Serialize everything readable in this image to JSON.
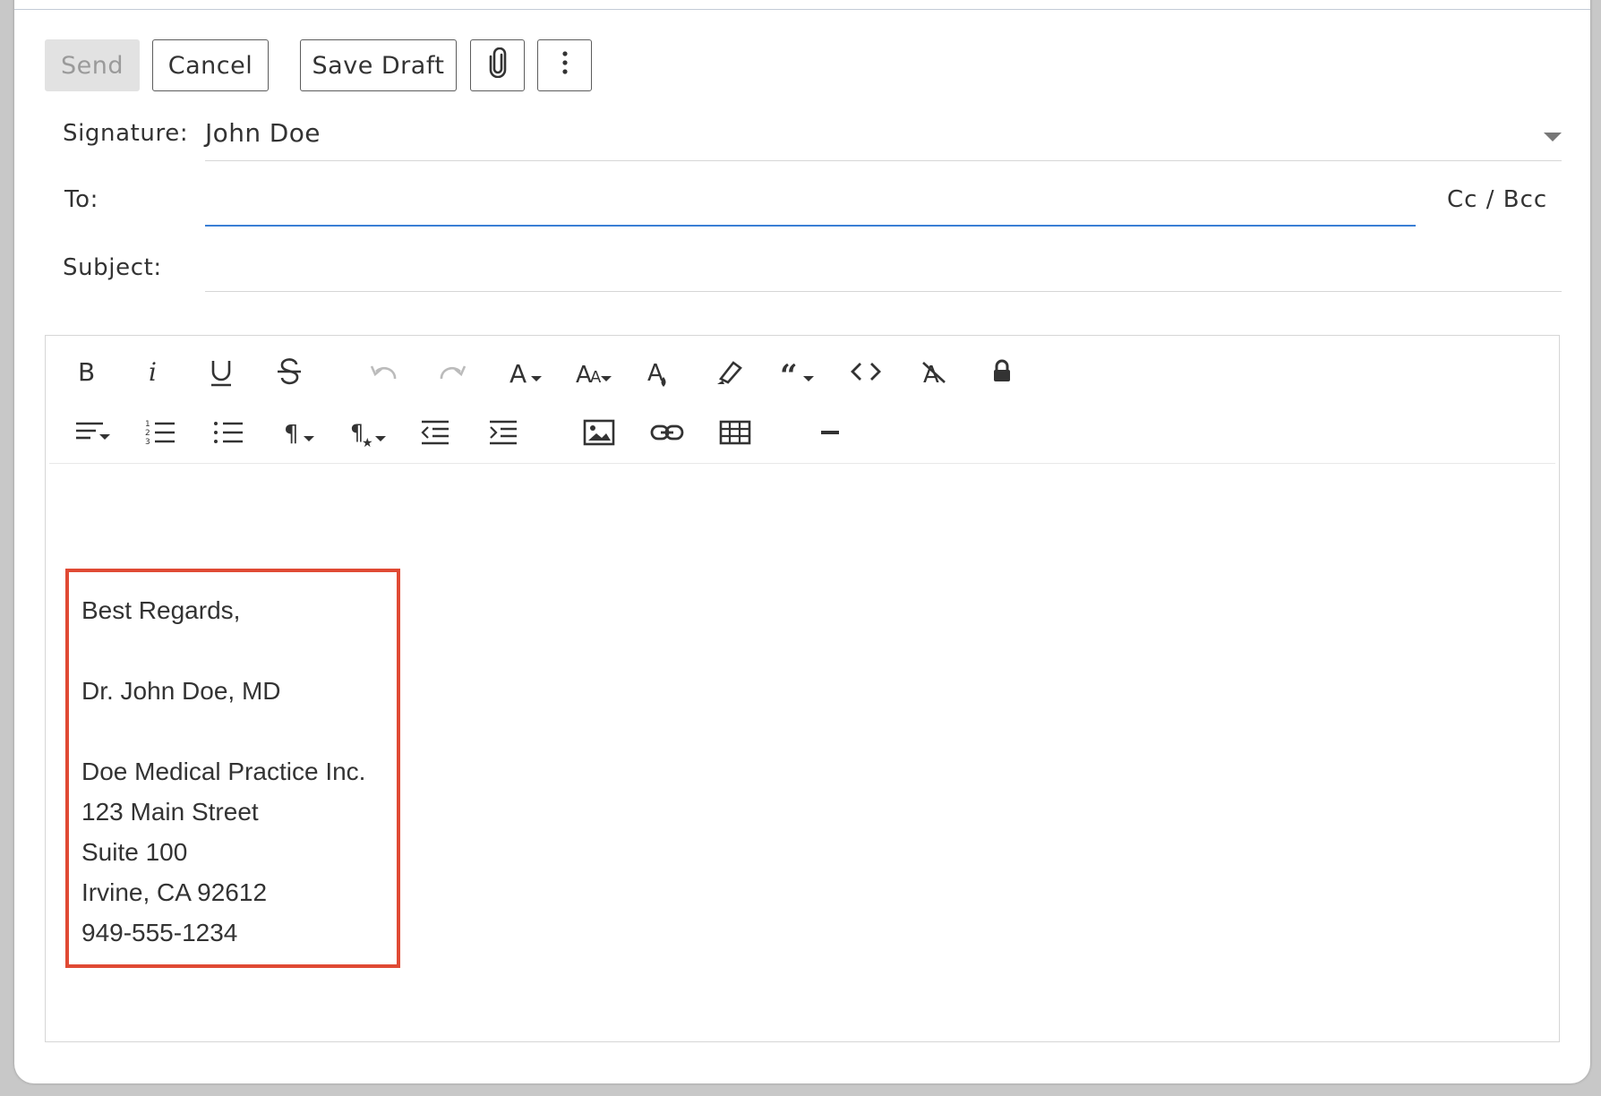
{
  "toolbar": {
    "send_label": "Send",
    "cancel_label": "Cancel",
    "save_draft_label": "Save Draft",
    "attach_icon": "paperclip-icon",
    "more_icon": "more-vertical-icon"
  },
  "fields": {
    "signature_label": "Signature:",
    "signature_value": "John Doe",
    "to_label": "To:",
    "to_value": "",
    "cc_bcc_label": "Cc / Bcc",
    "subject_label": "Subject:",
    "subject_value": ""
  },
  "editor_toolbar": {
    "row1": [
      "bold-icon",
      "italic-icon",
      "underline-icon",
      "strikethrough-icon",
      "undo-icon",
      "redo-icon",
      "font-family-icon",
      "font-size-icon",
      "text-color-icon",
      "highlight-icon",
      "quote-icon",
      "code-icon",
      "clear-format-icon",
      "lock-icon"
    ],
    "row2": [
      "align-icon",
      "ordered-list-icon",
      "unordered-list-icon",
      "paragraph-format-icon",
      "paragraph-style-icon",
      "outdent-icon",
      "indent-icon",
      "insert-image-icon",
      "insert-link-icon",
      "insert-table-icon",
      "horizontal-rule-icon"
    ]
  },
  "signature_block": {
    "lines": [
      "Best Regards,",
      "",
      "Dr. John Doe, MD",
      "",
      "Doe Medical Practice Inc.",
      "123 Main Street",
      "Suite 100",
      "Irvine, CA 92612",
      "949-555-1234"
    ]
  },
  "colors": {
    "highlight_border": "#e04a34",
    "focus_line": "#3a7fd5",
    "disabled_button": "#e2e2e2"
  }
}
